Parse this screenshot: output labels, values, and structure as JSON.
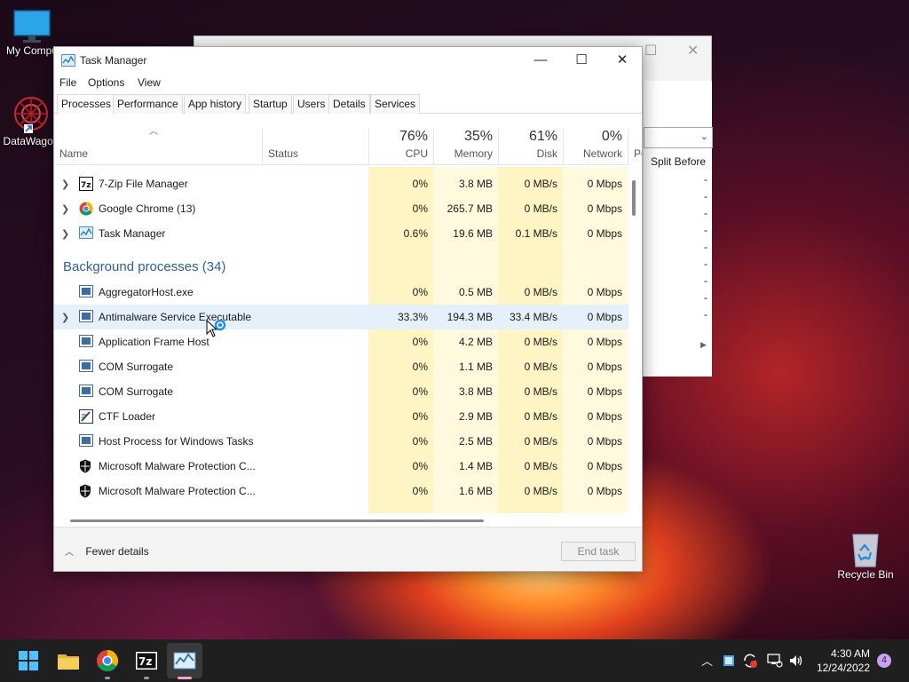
{
  "desktop": {
    "icons": [
      {
        "label": "My Compu"
      },
      {
        "label": "DataWagon"
      },
      {
        "label": "Recycle Bin"
      }
    ]
  },
  "background_window": {
    "column_header": "Split Before",
    "dash": "-"
  },
  "task_manager": {
    "title": "Task Manager",
    "menu": [
      "File",
      "Options",
      "View"
    ],
    "tabs": [
      "Processes",
      "Performance",
      "App history",
      "Startup",
      "Users",
      "Details",
      "Services"
    ],
    "columns": {
      "name": "Name",
      "status": "Status",
      "cpu": {
        "pct": "76%",
        "label": "CPU"
      },
      "memory": {
        "pct": "35%",
        "label": "Memory"
      },
      "disk": {
        "pct": "61%",
        "label": "Disk"
      },
      "network": {
        "pct": "0%",
        "label": "Network"
      },
      "power": "Po"
    },
    "group_label": "Background processes (34)",
    "apps": [
      {
        "name": "7-Zip File Manager",
        "cpu": "0%",
        "mem": "3.8 MB",
        "disk": "0 MB/s",
        "net": "0 Mbps"
      },
      {
        "name": "Google Chrome (13)",
        "cpu": "0%",
        "mem": "265.7 MB",
        "disk": "0 MB/s",
        "net": "0 Mbps"
      },
      {
        "name": "Task Manager",
        "cpu": "0.6%",
        "mem": "19.6 MB",
        "disk": "0.1 MB/s",
        "net": "0 Mbps"
      }
    ],
    "background": [
      {
        "name": "AggregatorHost.exe",
        "cpu": "0%",
        "mem": "0.5 MB",
        "disk": "0 MB/s",
        "net": "0 Mbps"
      },
      {
        "name": "Antimalware Service Executable",
        "cpu": "33.3%",
        "mem": "194.3 MB",
        "disk": "33.4 MB/s",
        "net": "0 Mbps"
      },
      {
        "name": "Application Frame Host",
        "cpu": "0%",
        "mem": "4.2 MB",
        "disk": "0 MB/s",
        "net": "0 Mbps"
      },
      {
        "name": "COM Surrogate",
        "cpu": "0%",
        "mem": "1.1 MB",
        "disk": "0 MB/s",
        "net": "0 Mbps"
      },
      {
        "name": "COM Surrogate",
        "cpu": "0%",
        "mem": "3.8 MB",
        "disk": "0 MB/s",
        "net": "0 Mbps"
      },
      {
        "name": "CTF Loader",
        "cpu": "0%",
        "mem": "2.9 MB",
        "disk": "0 MB/s",
        "net": "0 Mbps"
      },
      {
        "name": "Host Process for Windows Tasks",
        "cpu": "0%",
        "mem": "2.5 MB",
        "disk": "0 MB/s",
        "net": "0 Mbps"
      },
      {
        "name": "Microsoft Malware Protection C...",
        "cpu": "0%",
        "mem": "1.4 MB",
        "disk": "0 MB/s",
        "net": "0 Mbps"
      },
      {
        "name": "Microsoft Malware Protection C...",
        "cpu": "0%",
        "mem": "1.6 MB",
        "disk": "0 MB/s",
        "net": "0 Mbps"
      }
    ],
    "footer": {
      "fewer_details": "Fewer details",
      "end_task": "End task"
    }
  },
  "taskbar": {
    "time": "4:30 AM",
    "date": "12/24/2022",
    "notifications": "4"
  }
}
